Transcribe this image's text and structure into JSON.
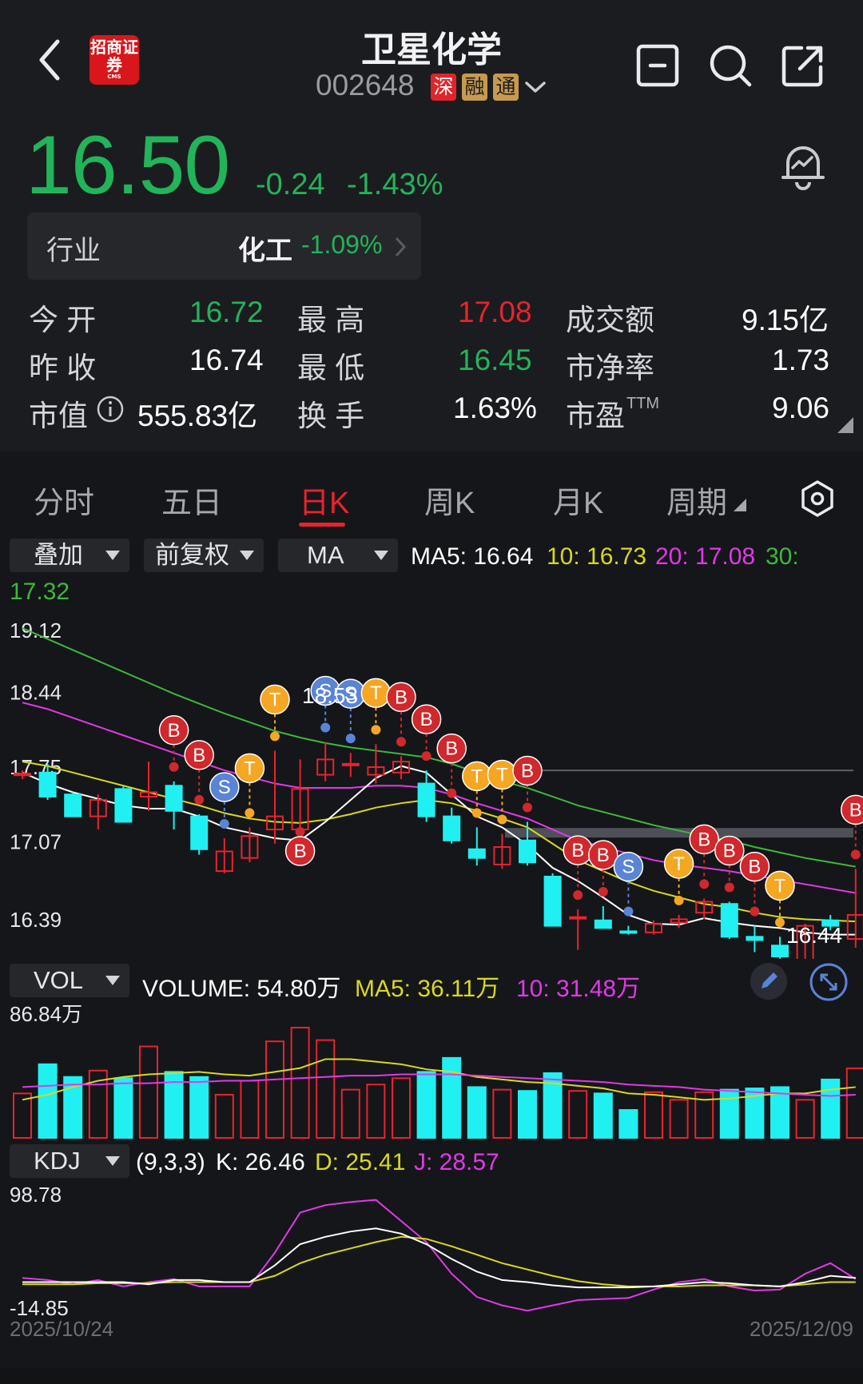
{
  "header": {
    "broker_logo_text": "招商证券",
    "broker_logo_sub": "CMS",
    "stock_name": "卫星化学",
    "stock_code": "002648",
    "tags": [
      "深",
      "融",
      "通"
    ]
  },
  "quote": {
    "price": "16.50",
    "change": "-0.24",
    "change_pct": "-1.43%",
    "industry_label": "行业",
    "industry_name": "化工",
    "industry_change": "-1.09%"
  },
  "stats": {
    "open_label": "今 开",
    "open": "16.72",
    "high_label": "最 高",
    "high": "17.08",
    "amount_label": "成交额",
    "amount": "9.15亿",
    "prev_close_label": "昨 收",
    "prev_close": "16.74",
    "low_label": "最 低",
    "low": "16.45",
    "pb_label": "市净率",
    "pb": "1.73",
    "mktcap_label": "市值",
    "mktcap": "555.83亿",
    "turnover_label": "换 手",
    "turnover": "1.63%",
    "pe_label": "市盈",
    "pe_sup": "TTM",
    "pe": "9.06"
  },
  "tabs": [
    "分时",
    "五日",
    "日K",
    "周K",
    "月K",
    "周期"
  ],
  "active_tab": "日K",
  "controls": {
    "overlay": "叠加",
    "adjust": "前复权",
    "indicator": "MA",
    "vol": "VOL",
    "kdj": "KDJ"
  },
  "ma_line": {
    "ma5": "MA5: 16.64",
    "ma10": "10: 16.73",
    "ma20": "20: 17.08",
    "ma30_label": "30:",
    "ma30_value": "17.32"
  },
  "vol_line": {
    "volume": "VOLUME: 54.80万",
    "ma5": "MA5: 36.11万",
    "ma10": "10: 31.48万"
  },
  "kdj_line": {
    "params": "(9,3,3)",
    "k": "K: 26.46",
    "d": "D: 25.41",
    "j": "J: 28.57"
  },
  "colors": {
    "up": "#e8232e",
    "down": "#20f0f2",
    "green": "#22b45a",
    "ma5": "#ffffff",
    "ma10": "#d8d820",
    "ma20": "#e238e8",
    "ma30": "#3cb83c",
    "marker_b": "#d0282c",
    "marker_s": "#5a84d6",
    "marker_t": "#f5a623"
  },
  "chart_data": {
    "type": "candlestick",
    "x_start": "2025/10/24",
    "x_end": "2025/12/09",
    "y_ticks": [
      "19.12",
      "18.44",
      "17.75",
      "17.07",
      "16.39"
    ],
    "ylim": [
      16.39,
      19.12
    ],
    "high_label": "18.53",
    "low_label": "16.44",
    "candles": [
      {
        "o": 17.78,
        "h": 17.82,
        "l": 17.74,
        "c": 17.79
      },
      {
        "o": 17.8,
        "h": 17.88,
        "l": 17.55,
        "c": 17.58
      },
      {
        "o": 17.6,
        "h": 17.62,
        "l": 17.4,
        "c": 17.4
      },
      {
        "o": 17.4,
        "h": 17.6,
        "l": 17.28,
        "c": 17.55
      },
      {
        "o": 17.65,
        "h": 17.68,
        "l": 17.35,
        "c": 17.35
      },
      {
        "o": 17.58,
        "h": 17.9,
        "l": 17.45,
        "c": 17.62
      },
      {
        "o": 17.68,
        "h": 17.72,
        "l": 17.28,
        "c": 17.45
      },
      {
        "o": 17.4,
        "h": 17.42,
        "l": 17.05,
        "c": 17.1
      },
      {
        "o": 16.9,
        "h": 17.2,
        "l": 16.88,
        "c": 17.08
      },
      {
        "o": 17.02,
        "h": 17.3,
        "l": 16.98,
        "c": 17.22
      },
      {
        "o": 17.28,
        "h": 18.0,
        "l": 17.15,
        "c": 17.4
      },
      {
        "o": 17.28,
        "h": 17.92,
        "l": 17.2,
        "c": 17.65
      },
      {
        "o": 17.78,
        "h": 18.08,
        "l": 17.72,
        "c": 17.92
      },
      {
        "o": 17.88,
        "h": 17.98,
        "l": 17.76,
        "c": 17.88
      },
      {
        "o": 17.78,
        "h": 18.06,
        "l": 17.7,
        "c": 17.85
      },
      {
        "o": 17.8,
        "h": 17.95,
        "l": 17.74,
        "c": 17.9
      },
      {
        "o": 17.7,
        "h": 17.82,
        "l": 17.35,
        "c": 17.4
      },
      {
        "o": 17.4,
        "h": 17.48,
        "l": 17.15,
        "c": 17.18
      },
      {
        "o": 17.1,
        "h": 17.3,
        "l": 16.95,
        "c": 17.02
      },
      {
        "o": 16.96,
        "h": 17.24,
        "l": 16.92,
        "c": 17.12
      },
      {
        "o": 17.18,
        "h": 17.35,
        "l": 16.95,
        "c": 16.98
      },
      {
        "o": 16.85,
        "h": 16.88,
        "l": 16.4,
        "c": 16.4
      },
      {
        "o": 16.48,
        "h": 16.55,
        "l": 16.18,
        "c": 16.48
      },
      {
        "o": 16.45,
        "h": 16.58,
        "l": 16.38,
        "c": 16.38
      },
      {
        "o": 16.35,
        "h": 16.4,
        "l": 16.32,
        "c": 16.34
      },
      {
        "o": 16.34,
        "h": 16.45,
        "l": 16.32,
        "c": 16.42
      },
      {
        "o": 16.43,
        "h": 16.5,
        "l": 16.38,
        "c": 16.46
      },
      {
        "o": 16.52,
        "h": 16.65,
        "l": 16.46,
        "c": 16.62
      },
      {
        "o": 16.6,
        "h": 16.62,
        "l": 16.28,
        "c": 16.3
      },
      {
        "o": 16.3,
        "h": 16.4,
        "l": 16.16,
        "c": 16.27
      },
      {
        "o": 16.22,
        "h": 16.3,
        "l": 16.1,
        "c": 16.12
      },
      {
        "o": 16.08,
        "h": 16.42,
        "l": 16.06,
        "c": 16.4
      },
      {
        "o": 16.45,
        "h": 16.5,
        "l": 16.36,
        "c": 16.4
      },
      {
        "o": 16.28,
        "h": 16.92,
        "l": 16.2,
        "c": 16.5
      }
    ],
    "ma5": [
      17.8,
      17.7,
      17.62,
      17.56,
      17.5,
      17.47,
      17.47,
      17.4,
      17.3,
      17.25,
      17.2,
      17.18,
      17.35,
      17.55,
      17.75,
      17.86,
      17.8,
      17.6,
      17.4,
      17.3,
      17.14,
      16.93,
      16.81,
      16.66,
      16.5,
      16.42,
      16.41,
      16.47,
      16.43,
      16.4,
      16.38,
      16.34,
      16.32,
      16.32
    ],
    "ma10": [
      17.9,
      17.86,
      17.8,
      17.74,
      17.68,
      17.62,
      17.56,
      17.5,
      17.43,
      17.38,
      17.35,
      17.34,
      17.37,
      17.42,
      17.48,
      17.52,
      17.55,
      17.52,
      17.45,
      17.38,
      17.3,
      17.15,
      17.0,
      16.9,
      16.8,
      16.72,
      16.66,
      16.6,
      16.57,
      16.52,
      16.48,
      16.46,
      16.45,
      16.44
    ],
    "ma20": [
      18.44,
      18.38,
      18.3,
      18.22,
      18.14,
      18.06,
      17.98,
      17.9,
      17.82,
      17.76,
      17.7,
      17.66,
      17.66,
      17.66,
      17.68,
      17.68,
      17.66,
      17.6,
      17.52,
      17.45,
      17.38,
      17.28,
      17.18,
      17.12,
      17.06,
      17.0,
      16.96,
      16.93,
      16.9,
      16.86,
      16.82,
      16.78,
      16.74,
      16.7
    ],
    "ma30": [
      19.12,
      19.02,
      18.92,
      18.82,
      18.72,
      18.62,
      18.52,
      18.43,
      18.34,
      18.26,
      18.18,
      18.12,
      18.07,
      18.03,
      18.0,
      17.97,
      17.94,
      17.88,
      17.8,
      17.72,
      17.66,
      17.58,
      17.5,
      17.44,
      17.38,
      17.32,
      17.27,
      17.22,
      17.18,
      17.12,
      17.07,
      17.02,
      16.98,
      16.94
    ],
    "volume_max_label": "86.84万",
    "volume_max": 86.84,
    "volume": [
      35,
      58,
      48,
      53,
      47,
      72,
      52,
      48,
      34,
      45,
      76,
      86.84,
      77,
      38,
      42,
      47,
      52,
      63,
      40,
      38,
      37,
      51,
      37,
      35,
      22,
      36,
      30,
      36,
      38,
      39,
      40,
      30,
      46,
      54.8
    ],
    "vol_ma5": [
      30,
      34,
      40,
      45,
      48,
      50,
      51,
      52,
      50,
      49,
      52,
      55,
      62,
      62,
      60,
      58,
      54,
      52,
      48,
      46,
      44,
      43,
      41,
      39,
      35,
      34,
      32,
      30,
      31,
      33,
      35,
      35,
      38,
      40
    ],
    "vol_ma10": [
      40,
      41,
      42,
      42,
      43,
      43,
      44,
      44,
      45,
      45,
      46,
      47,
      48,
      49,
      49,
      50,
      50,
      50,
      49,
      48,
      47,
      46,
      45,
      44,
      42,
      41,
      40,
      38,
      37,
      36,
      35,
      34,
      33,
      34
    ],
    "kdj_top_label": "98.78",
    "kdj_bottom_label": "-14.85",
    "kdj_range": [
      -14.85,
      98.78
    ],
    "kdj_k": [
      12,
      12,
      12,
      12,
      12,
      10,
      14,
      14,
      12,
      12,
      28,
      48,
      55,
      60,
      63,
      58,
      48,
      34,
      22,
      14,
      12,
      9,
      7,
      7,
      7,
      8,
      10,
      12,
      11,
      9,
      8,
      12,
      18,
      16
    ],
    "kdj_d": [
      10,
      10,
      10,
      11,
      11,
      11,
      12,
      12,
      12,
      12,
      18,
      30,
      38,
      44,
      50,
      55,
      53,
      46,
      38,
      30,
      24,
      18,
      13,
      10,
      8,
      8,
      8,
      9,
      9,
      9,
      8,
      10,
      12,
      12
    ],
    "kdj_j": [
      16,
      14,
      10,
      14,
      8,
      12,
      15,
      8,
      8,
      8,
      40,
      78,
      85,
      88,
      90,
      70,
      50,
      20,
      -2,
      -10,
      -15,
      -10,
      -5,
      -4,
      -3,
      5,
      12,
      15,
      8,
      4,
      5,
      20,
      30,
      15
    ],
    "signals": [
      {
        "i": 6,
        "label": "B",
        "pos": "up"
      },
      {
        "i": 7,
        "label": "B",
        "pos": "up"
      },
      {
        "i": 8,
        "label": "S",
        "pos": "up"
      },
      {
        "i": 9,
        "label": "T",
        "pos": "up"
      },
      {
        "i": 10,
        "label": "T",
        "pos": "up"
      },
      {
        "i": 11,
        "label": "B",
        "pos": "down"
      },
      {
        "i": 12,
        "label": "S",
        "pos": "up"
      },
      {
        "i": 13,
        "label": "S",
        "pos": "up"
      },
      {
        "i": 14,
        "label": "T",
        "pos": "up"
      },
      {
        "i": 15,
        "label": "B",
        "pos": "up"
      },
      {
        "i": 16,
        "label": "B",
        "pos": "up"
      },
      {
        "i": 17,
        "label": "B",
        "pos": "up"
      },
      {
        "i": 18,
        "label": "T",
        "pos": "up"
      },
      {
        "i": 19,
        "label": "T",
        "pos": "up"
      },
      {
        "i": 20,
        "label": "B",
        "pos": "up"
      },
      {
        "i": 22,
        "label": "B",
        "pos": "up"
      },
      {
        "i": 23,
        "label": "B",
        "pos": "up"
      },
      {
        "i": 24,
        "label": "S",
        "pos": "up"
      },
      {
        "i": 26,
        "label": "T",
        "pos": "up"
      },
      {
        "i": 27,
        "label": "B",
        "pos": "up"
      },
      {
        "i": 28,
        "label": "B",
        "pos": "up"
      },
      {
        "i": 29,
        "label": "B",
        "pos": "up"
      },
      {
        "i": 30,
        "label": "T",
        "pos": "up"
      },
      {
        "i": 33,
        "label": "B",
        "pos": "up"
      }
    ]
  }
}
